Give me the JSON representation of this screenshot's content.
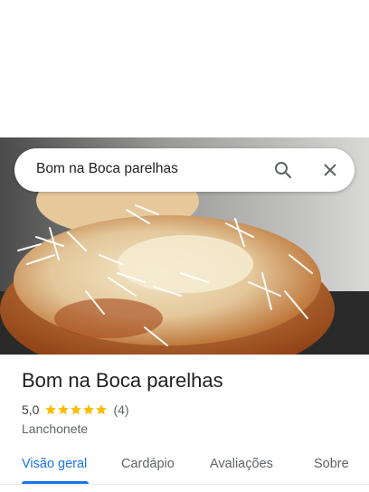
{
  "search": {
    "query": "Bom na Boca parelhas",
    "search_icon": "search-icon",
    "close_icon": "close-icon"
  },
  "place": {
    "name": "Bom na Boca parelhas",
    "rating": "5,0",
    "rating_value": 5.0,
    "rating_max": 5,
    "review_count": "(4)",
    "category": "Lanchonete",
    "photo": "photo-coconut-bread"
  },
  "tabs": [
    {
      "label": "Visão geral",
      "active": true
    },
    {
      "label": "Cardápio",
      "active": false
    },
    {
      "label": "Avaliações",
      "active": false
    },
    {
      "label": "Sobre",
      "active": false
    }
  ],
  "colors": {
    "accent": "#1a73e8",
    "star": "#fbbc04",
    "text": "#202124",
    "muted": "#5f6368"
  }
}
